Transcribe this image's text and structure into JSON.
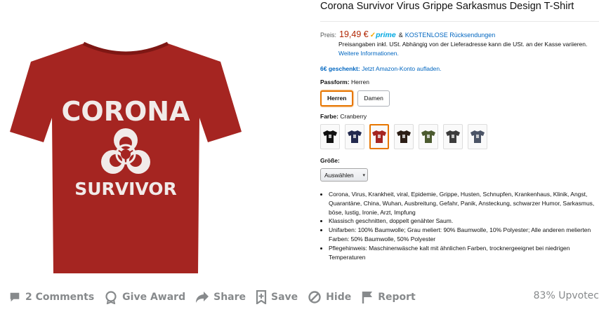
{
  "product": {
    "image_text_top": "CORONA",
    "image_text_bottom": "SURVIVOR",
    "shirt_color": "#a52521",
    "title": "Corona Survivor Virus Grippe Sarkasmus Design T-Shirt",
    "price_label": "Preis:",
    "price": "19,49 €",
    "prime_check": "✓",
    "prime": "prime",
    "amp": "&",
    "free_returns": "KOSTENLOSE Rücksendungen",
    "price_note": "Preisangaben inkl. USt. Abhängig von der Lieferadresse kann die USt. an der Kasse variieren.",
    "more_info": "Weitere Informationen.",
    "gift_bold": "6€ geschenkt:",
    "gift_text": "Jetzt Amazon-Konto aufladen.",
    "fit_label": "Passform:",
    "fit_value": "Herren",
    "fit_options": [
      "Herren",
      "Damen"
    ],
    "color_label": "Farbe:",
    "color_value": "Cranberry",
    "color_swatches": [
      "#111111",
      "#232a4f",
      "#a52521",
      "#2b1d15",
      "#4b5a2f",
      "#3c3c3c",
      "#4b5466"
    ],
    "size_label": "Größe:",
    "size_select": "Auswählen",
    "size_caret": "▾",
    "bullets": [
      "Corona, Virus, Krankheit, viral, Epidemie, Grippe, Husten, Schnupfen, Krankenhaus, Klinik, Angst, Quarantäne, China, Wuhan, Ausbreitung, Gefahr, Panik, Ansteckung, schwarzer Humor, Sarkasmus, böse, lustig, Ironie, Arzt, Impfung",
      "Klassisch geschnitten, doppelt genähter Saum.",
      "Unifarben: 100% Baumwolle; Grau meliert: 90% Baumwolle, 10% Polyester; Alle anderen melierten Farben: 50% Baumwolle, 50% Polyester",
      "Pflegehinweis: Maschinenwäsche kalt mit ähnlichen Farben, trocknergeeignet bei niedrigen Temperaturen"
    ]
  },
  "actions": {
    "comments": "2 Comments",
    "award": "Give Award",
    "share": "Share",
    "save": "Save",
    "hide": "Hide",
    "report": "Report",
    "upvoted": "83% Upvotec"
  },
  "colors": {
    "accent_orange": "#e77600",
    "link_blue": "#0066c0",
    "price_red": "#b12704",
    "reddit_gray": "#878a8c"
  }
}
